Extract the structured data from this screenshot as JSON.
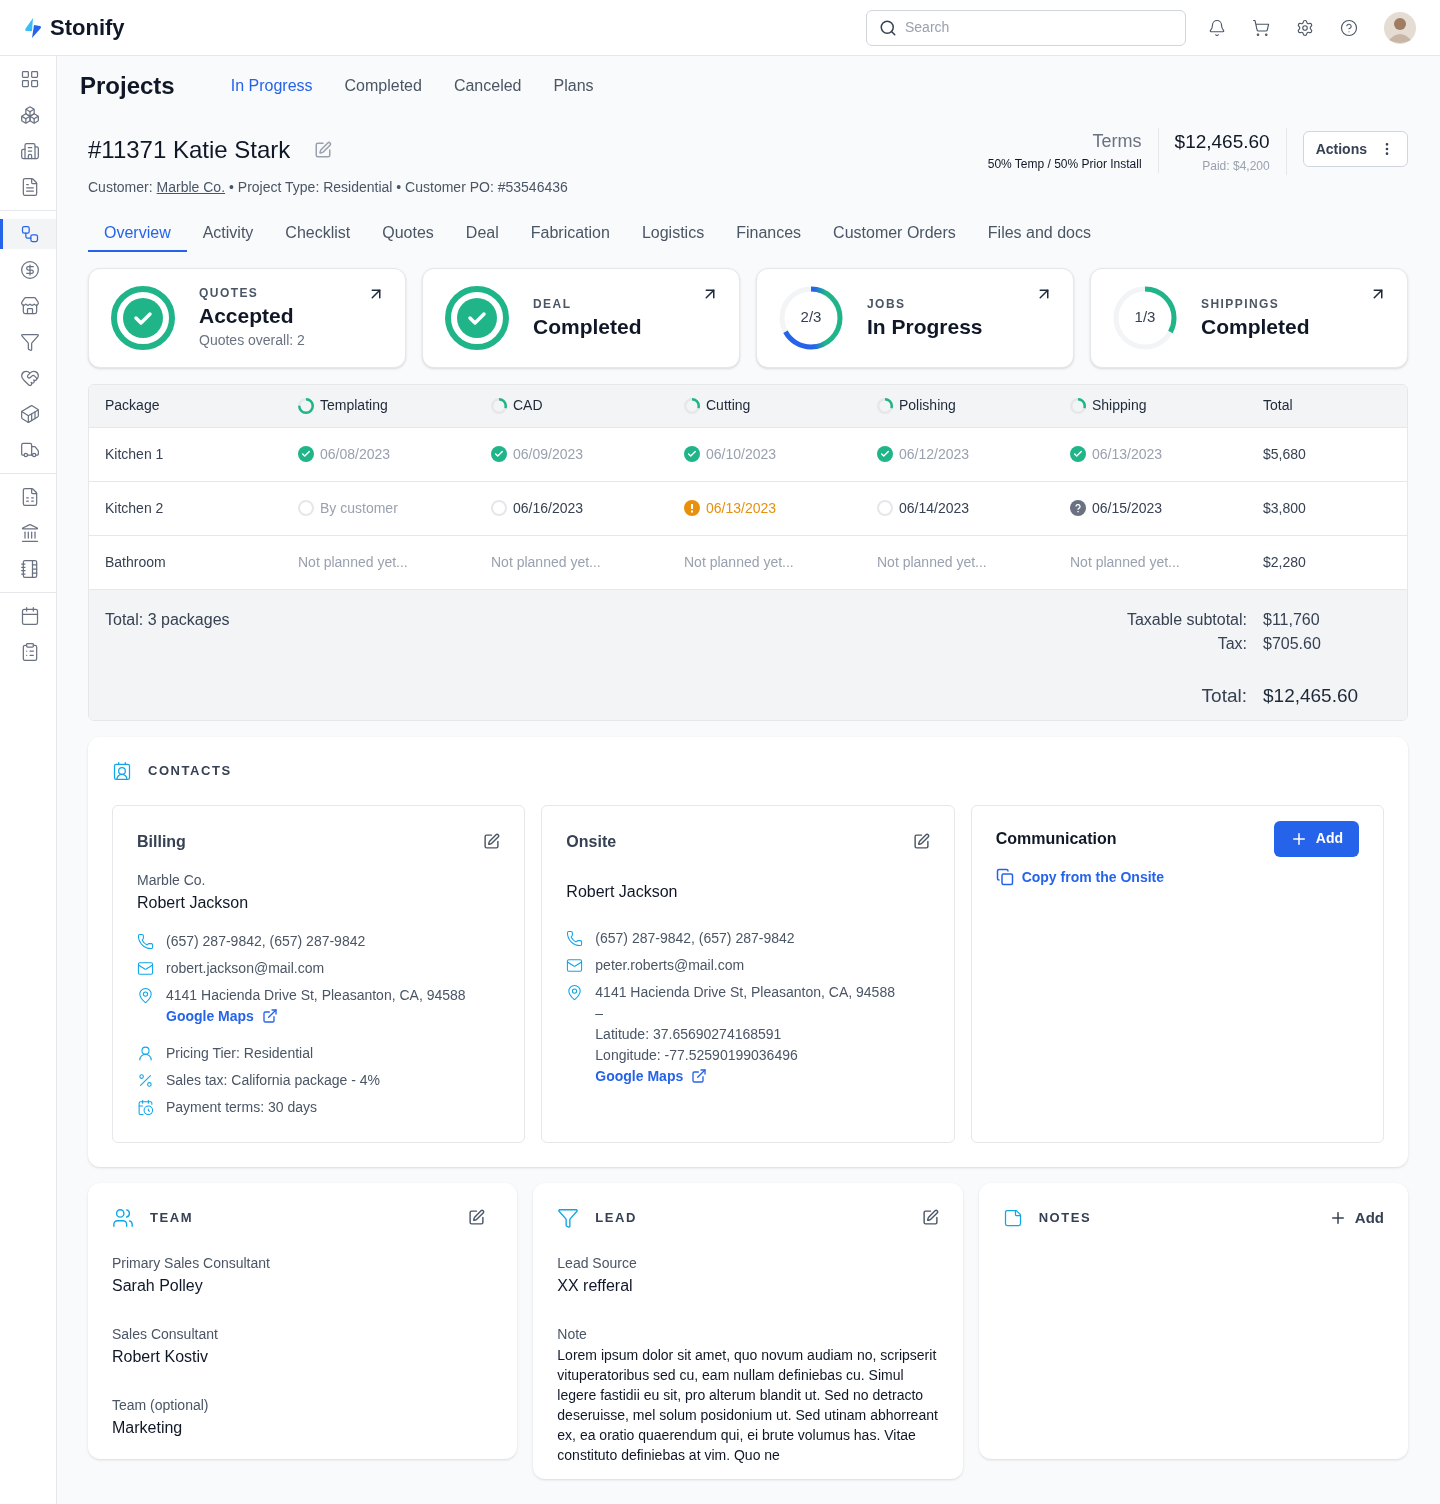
{
  "brand": {
    "name": "Stonify"
  },
  "search": {
    "placeholder": "Search"
  },
  "sidebar": {
    "groups": [
      [
        {
          "selected": false
        },
        {
          "selected": false
        },
        {
          "selected": false
        },
        {
          "selected": false
        }
      ],
      [
        {
          "selected": true
        },
        {
          "selected": false
        },
        {
          "selected": false
        },
        {
          "selected": false
        },
        {
          "selected": false
        },
        {
          "selected": false
        },
        {
          "selected": false
        }
      ],
      [
        {
          "selected": false
        },
        {
          "selected": false
        },
        {
          "selected": false
        }
      ],
      [
        {
          "selected": false
        },
        {
          "selected": false
        }
      ]
    ]
  },
  "page_title": "Projects",
  "top_tabs": [
    {
      "label": "In Progress",
      "selected": true
    },
    {
      "label": "Completed",
      "selected": false
    },
    {
      "label": "Canceled",
      "selected": false
    },
    {
      "label": "Plans",
      "selected": false
    }
  ],
  "project": {
    "title": "#11371 Katie Stark",
    "customer_label": "Customer:",
    "customer": "Marble Co.",
    "details": "• Project Type: Residential • Customer PO: #53546436",
    "terms_label": "Terms",
    "terms": "50% Temp / 50% Prior Install",
    "amount": "$12,465.60",
    "paid": "Paid: $4,200",
    "actions": "Actions"
  },
  "tabs": [
    {
      "label": "Overview",
      "selected": true
    },
    {
      "label": "Activity",
      "selected": false
    },
    {
      "label": "Checklist",
      "selected": false
    },
    {
      "label": "Quotes",
      "selected": false
    },
    {
      "label": "Deal",
      "selected": false
    },
    {
      "label": "Fabrication",
      "selected": false
    },
    {
      "label": "Logistics",
      "selected": false
    },
    {
      "label": "Finances",
      "selected": false
    },
    {
      "label": "Customer Orders",
      "selected": false
    },
    {
      "label": "Files and docs",
      "selected": false
    }
  ],
  "summary_cards": [
    {
      "kind": "check",
      "label": "QUOTES",
      "status": "Accepted",
      "sub": "Quotes overall: 2"
    },
    {
      "kind": "check",
      "label": "DEAL",
      "status": "Completed"
    },
    {
      "kind": "ring",
      "label": "JOBS",
      "status": "In Progress",
      "count": "2/3",
      "level": 0.67
    },
    {
      "kind": "ring",
      "label": "SHIPPINGS",
      "status": "Completed",
      "count": "1/3",
      "level": 0.33
    }
  ],
  "table": {
    "columns": [
      {
        "label": "Package"
      },
      {
        "label": "Templating",
        "level": 0.75
      },
      {
        "label": "CAD",
        "level": 0.3
      },
      {
        "label": "Cutting",
        "level": 0.3
      },
      {
        "label": "Polishing",
        "level": 0.3
      },
      {
        "label": "Shipping",
        "level": 0.3
      },
      {
        "label": "Total"
      }
    ],
    "rows": [
      {
        "package": "Kitchen 1",
        "stages": [
          {
            "kind": "done",
            "text": "06/08/2023"
          },
          {
            "kind": "done",
            "text": "06/09/2023"
          },
          {
            "kind": "done",
            "text": "06/10/2023"
          },
          {
            "kind": "done",
            "text": "06/12/2023"
          },
          {
            "kind": "done",
            "text": "06/13/2023"
          }
        ],
        "total": "$5,680"
      },
      {
        "package": "Kitchen 2",
        "stages": [
          {
            "kind": "open",
            "muted": true,
            "text": "By customer"
          },
          {
            "kind": "open",
            "muted": false,
            "text": "06/16/2023"
          },
          {
            "kind": "warning",
            "text": "06/13/2023"
          },
          {
            "kind": "open",
            "muted": false,
            "text": "06/14/2023"
          },
          {
            "kind": "unknown",
            "text": "06/15/2023"
          }
        ],
        "total": "$3,800"
      },
      {
        "package": "Bathroom",
        "stages": [
          {
            "kind": "none",
            "text": "Not planned yet..."
          },
          {
            "kind": "none",
            "text": "Not planned yet..."
          },
          {
            "kind": "none",
            "text": "Not planned yet..."
          },
          {
            "kind": "none",
            "text": "Not planned yet..."
          },
          {
            "kind": "none",
            "text": "Not planned yet..."
          }
        ],
        "total": "$2,280"
      }
    ],
    "footer": {
      "count": "Total: 3 packages",
      "lines": [
        {
          "label": "Taxable subtotal:",
          "value": "$11,760"
        },
        {
          "label": "Tax:",
          "value": "$705.60"
        }
      ],
      "total_label": "Total:",
      "total": "$12,465.60"
    }
  },
  "contacts": {
    "title": "CONTACTS",
    "billing": {
      "title": "Billing",
      "company": "Marble Co.",
      "name": "Robert Jackson",
      "phone": "(657) 287-9842, (657) 287-9842",
      "email": "robert.jackson@mail.com",
      "address": "4141 Hacienda Drive St, Pleasanton, CA, 94588",
      "maps": "Google Maps",
      "tier": "Pricing Tier: Residential",
      "tax": "Sales tax: California package - 4%",
      "terms": "Payment terms: 30 days"
    },
    "onsite": {
      "title": "Onsite",
      "name": "Robert Jackson",
      "phone": "(657) 287-9842, (657) 287-9842",
      "email": "peter.roberts@mail.com",
      "address": "4141 Hacienda Drive St, Pleasanton, CA, 94588",
      "dash": "–",
      "latitude": "Latitude: 37.65690274168591",
      "longitude": "Longitude: -77.52590199036496",
      "maps": "Google Maps"
    },
    "communication": {
      "title": "Communication",
      "add": "Add",
      "copy": "Copy from the Onsite"
    }
  },
  "team": {
    "title": "TEAM",
    "fields": [
      {
        "label": "Primary Sales Consultant",
        "value": "Sarah Polley"
      },
      {
        "label": "Sales Consultant",
        "value": "Robert Kostiv"
      },
      {
        "label": "Team (optional)",
        "value": "Marketing"
      }
    ]
  },
  "lead": {
    "title": "LEAD",
    "source_label": "Lead Source",
    "source": "XX refferal",
    "note_label": "Note",
    "note": "Lorem ipsum dolor sit amet, quo novum audiam no, scripserit vituperatoribus sed cu, eam nullam definiebas cu. Simul legere fastidii eu sit, pro alterum blandit ut. Sed no detracto deseruisse, mel solum posidonium ut. Sed utinam abhorreant ex, ea oratio quaerendum qui, ei brute volumus has. Vitae constituto definiebas at vim. Quo ne"
  },
  "notes": {
    "title": "NOTES",
    "add": "Add"
  }
}
